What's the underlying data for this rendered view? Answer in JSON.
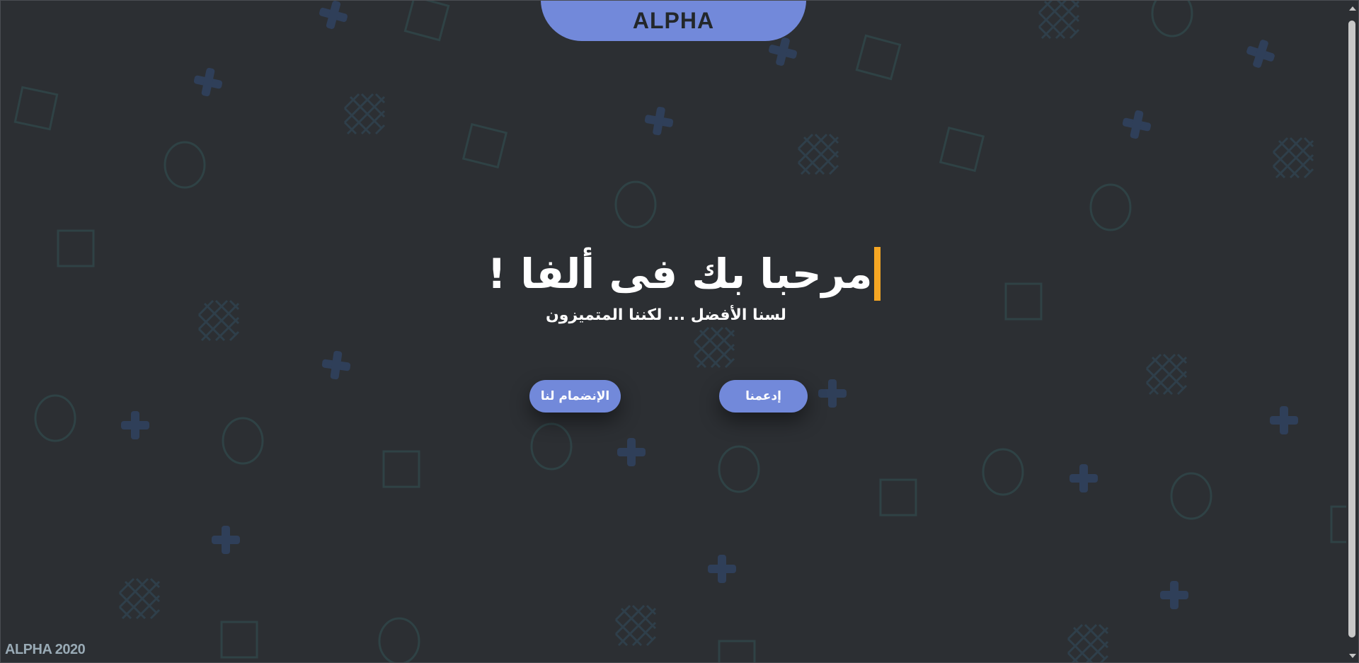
{
  "header": {
    "brand": "ALPHA"
  },
  "hero": {
    "title": "مرحبا بك فى ألفا !",
    "subtitle": "لسنا الأفضل ... لكننا المتميزون"
  },
  "actions": {
    "join_label": "الإنضمام لنا",
    "support_label": "إدعمنا"
  },
  "footer": {
    "copyright": "ALPHA 2020"
  },
  "colors": {
    "background": "#2c2f33",
    "accent": "#7289da",
    "caret": "#f5a623",
    "pattern_stroke": "#2f4245",
    "pattern_plus": "#2f3f59"
  },
  "icons": {
    "background_pattern": "geometric-shapes-pattern",
    "scroll_up": "triangle-up",
    "scroll_down": "triangle-down"
  }
}
